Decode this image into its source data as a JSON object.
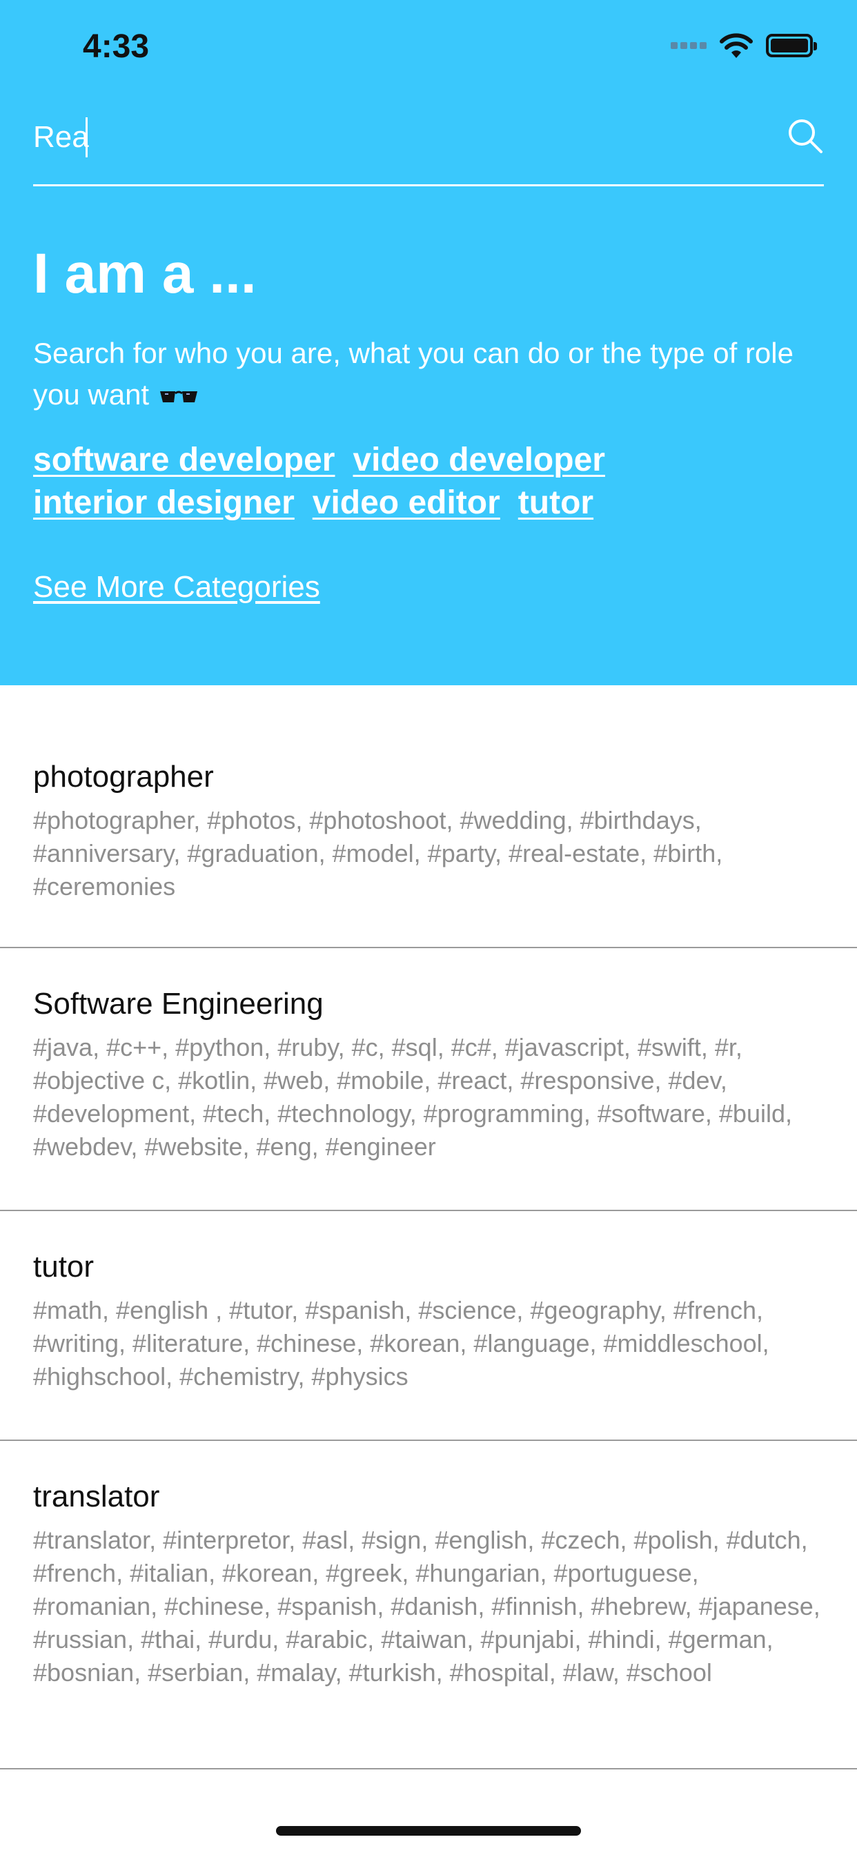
{
  "status_bar": {
    "time": "4:33"
  },
  "search": {
    "value": "Rea"
  },
  "intro": {
    "headline": "I am a ...",
    "subtitle": "Search for who you are, what you can do or the type of role you want",
    "emoji_icon": "eyeglasses-icon"
  },
  "suggested_tags": [
    "software developer",
    "video developer",
    "interior designer",
    "video editor",
    "tutor"
  ],
  "see_more_label": "See More Categories",
  "results": [
    {
      "title": "photographer",
      "tags": "#photographer, #photos, #photoshoot, #wedding, #birthdays, #anniversary, #graduation, #model, #party, #real-estate, #birth, #ceremonies"
    },
    {
      "title": "Software Engineering",
      "tags": "#java, #c++, #python, #ruby, #c, #sql, #c#, #javascript, #swift, #r, #objective c, #kotlin, #web, #mobile, #react, #responsive, #dev, #development, #tech, #technology, #programming, #software, #build, #webdev, #website, #eng, #engineer"
    },
    {
      "title": "tutor",
      "tags": "#math, #english , #tutor, #spanish, #science, #geography, #french, #writing, #literature, #chinese, #korean, #language, #middleschool, #highschool, #chemistry, #physics"
    },
    {
      "title": "translator",
      "tags": "#translator, #interpretor, #asl, #sign, #english, #czech, #polish, #dutch, #french, #italian, #korean, #greek, #hungarian, #portuguese, #romanian, #chinese, #spanish, #danish, #finnish, #hebrew, #japanese, #russian, #thai, #urdu, #arabic, #taiwan, #punjabi, #hindi, #german, #bosnian, #serbian, #malay, #turkish, #hospital, #law, #school"
    }
  ],
  "colors": {
    "header_bg": "#3ac8fc",
    "tag_text": "#8e8e8e",
    "divider": "#9a9a9a"
  }
}
